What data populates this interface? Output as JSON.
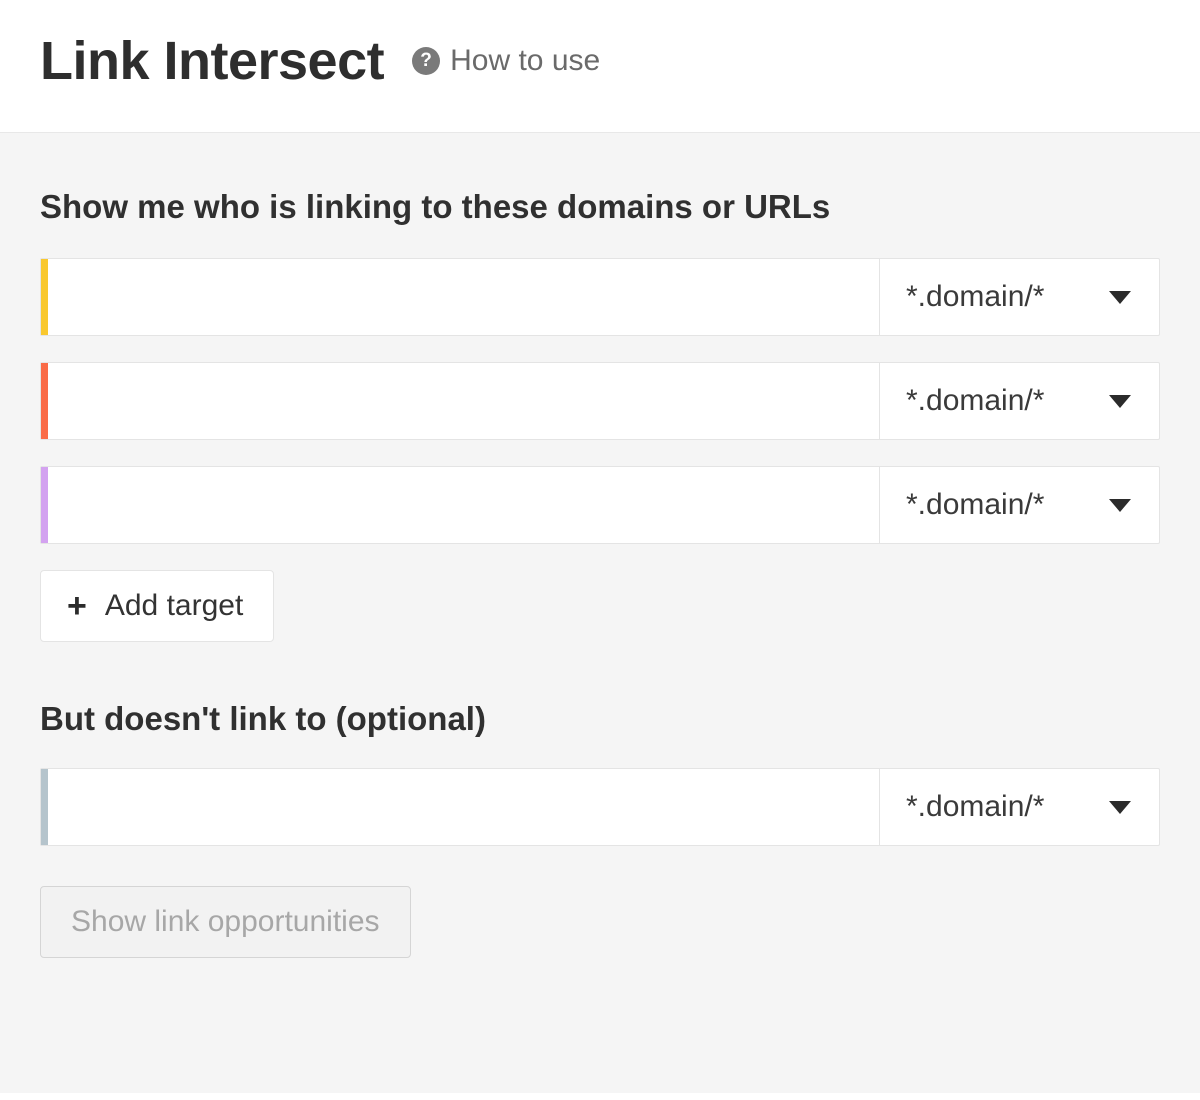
{
  "header": {
    "title": "Link Intersect",
    "how_to_use_label": "How to use"
  },
  "main": {
    "targets_section_label": "Show me who is linking to these domains or URLs",
    "targets": [
      {
        "color": "#f9c82e",
        "value": "",
        "mode": "*.domain/*"
      },
      {
        "color": "#fa6b47",
        "value": "",
        "mode": "*.domain/*"
      },
      {
        "color": "#d3a2f0",
        "value": "",
        "mode": "*.domain/*"
      }
    ],
    "add_target_label": "Add target",
    "exclude_section_label": "But doesn't link to (optional)",
    "exclude": [
      {
        "color": "#b5c4cc",
        "value": "",
        "mode": "*.domain/*"
      }
    ],
    "submit_label": "Show link opportunities"
  }
}
